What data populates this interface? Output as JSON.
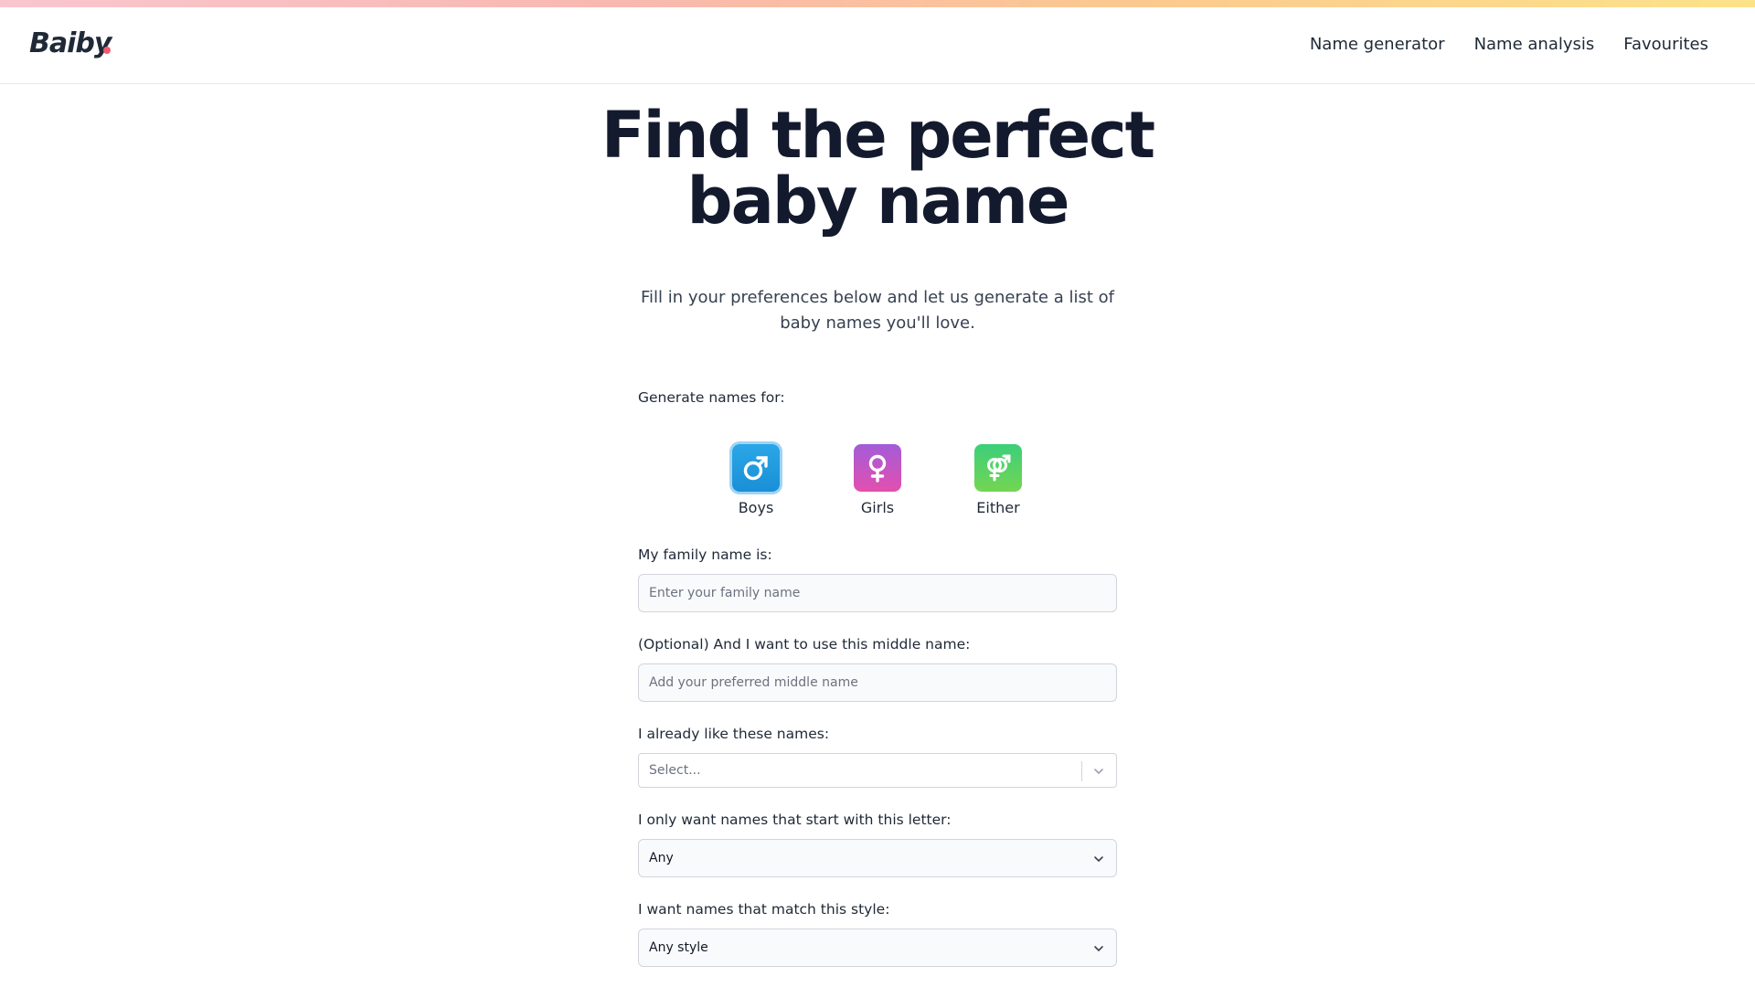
{
  "header": {
    "logo": "Baiby",
    "nav": [
      "Name generator",
      "Name analysis",
      "Favourites"
    ]
  },
  "hero": {
    "title": "Find the perfect baby name",
    "subtitle": "Fill in your preferences below and let us generate a list of baby names you'll love."
  },
  "form": {
    "gender_label": "Generate names for:",
    "genders": [
      {
        "label": "Boys",
        "icon": "male-symbol-icon",
        "selected": true,
        "color": "#1a8fd6"
      },
      {
        "label": "Girls",
        "icon": "female-symbol-icon",
        "selected": false,
        "color": "#c953c4"
      },
      {
        "label": "Either",
        "icon": "gender-both-icon",
        "selected": false,
        "color": "#4ccf6c"
      }
    ],
    "family_name": {
      "label": "My family name is:",
      "placeholder": "Enter your family name",
      "value": ""
    },
    "middle_name": {
      "label": "(Optional) And I want to use this middle name:",
      "placeholder": "Add your preferred middle name",
      "value": ""
    },
    "liked_names": {
      "label": "I already like these names:",
      "placeholder": "Select..."
    },
    "start_letter": {
      "label": "I only want names that start with this letter:",
      "value": "Any"
    },
    "style": {
      "label": "I want names that match this style:",
      "value": "Any style"
    }
  },
  "colors": {
    "accent_dot": "#ef5b6e",
    "title_text": "#141a2e"
  }
}
